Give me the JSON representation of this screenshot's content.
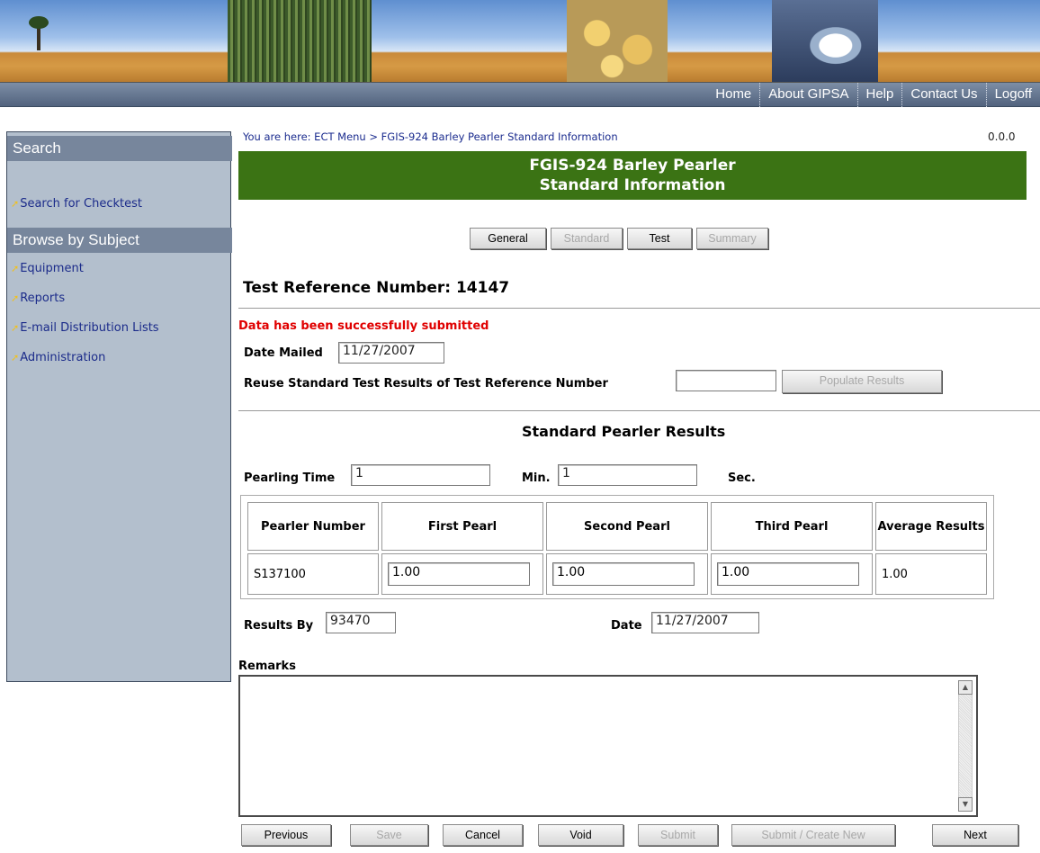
{
  "nav": {
    "items": [
      "Home",
      "About GIPSA",
      "Help",
      "Contact Us",
      "Logoff"
    ]
  },
  "sidebar": {
    "search_header": "Search",
    "search_link": "Search for Checktest",
    "browse_header": "Browse by Subject",
    "links": [
      "Equipment",
      "Reports",
      "E-mail Distribution Lists",
      "Administration"
    ]
  },
  "breadcrumb": "You are here: ECT Menu > FGIS-924 Barley Pearler Standard Information",
  "version": "0.0.0",
  "page_title_line1": "FGIS-924 Barley Pearler",
  "page_title_line2": "Standard Information",
  "tabs": [
    {
      "label": "General",
      "enabled": true
    },
    {
      "label": "Standard",
      "enabled": false
    },
    {
      "label": "Test",
      "enabled": true
    },
    {
      "label": "Summary",
      "enabled": false
    }
  ],
  "test_reference": "Test Reference Number: 14147",
  "success_message": "Data has been successfully submitted",
  "date_mailed": {
    "label": "Date Mailed",
    "value": "11/27/2007"
  },
  "reuse": {
    "label": "Reuse Standard Test Results of Test Reference Number",
    "value": "",
    "button": "Populate Results"
  },
  "section_title": "Standard Pearler Results",
  "pearling": {
    "label": "Pearling Time",
    "min_value": "1",
    "min_label": "Min.",
    "sec_value": "1",
    "sec_label": "Sec."
  },
  "results_table": {
    "headers": [
      "Pearler Number",
      "First Pearl",
      "Second Pearl",
      "Third Pearl",
      "Average Results"
    ],
    "row": {
      "pearler_number": "S137100",
      "first": "1.00",
      "second": "1.00",
      "third": "1.00",
      "average": "1.00"
    }
  },
  "results_by": {
    "label": "Results By",
    "value": "93470"
  },
  "date": {
    "label": "Date",
    "value": "11/27/2007"
  },
  "remarks": {
    "label": "Remarks",
    "value": ""
  },
  "actions": {
    "previous": "Previous",
    "save": "Save",
    "cancel": "Cancel",
    "void": "Void",
    "submit": "Submit",
    "submit_create_new": "Submit / Create New",
    "next": "Next"
  },
  "colors": {
    "title_bar": "#3b7314",
    "nav_bar": "#6a7b95",
    "sidebar": "#b3bfcd",
    "success": "#e00000",
    "link": "#1b2b8a"
  }
}
